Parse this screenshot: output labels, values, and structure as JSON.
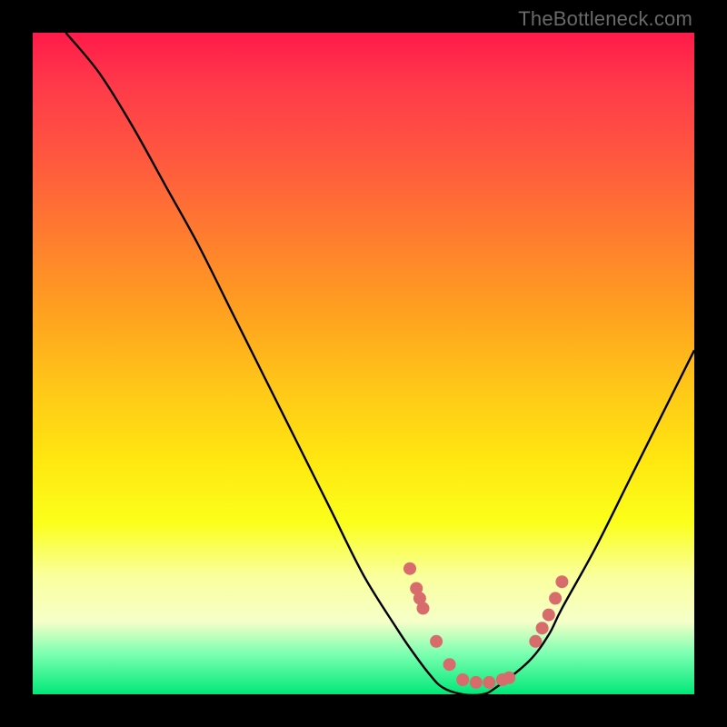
{
  "watermark": "TheBottleneck.com",
  "chart_data": {
    "type": "line",
    "title": "",
    "xlabel": "",
    "ylabel": "",
    "xlim": [
      0,
      100
    ],
    "ylim": [
      0,
      100
    ],
    "series": [
      {
        "name": "bottleneck-curve",
        "x": [
          5,
          10,
          15,
          20,
          25,
          30,
          35,
          40,
          45,
          50,
          55,
          57,
          60,
          62,
          65,
          68,
          70,
          75,
          78,
          80,
          85,
          90,
          95,
          100
        ],
        "values": [
          100,
          94,
          86,
          77,
          68,
          58,
          48,
          38,
          28,
          18,
          10,
          7,
          3,
          1,
          0,
          0,
          1,
          5,
          9,
          13,
          22,
          32,
          42,
          52
        ]
      }
    ],
    "markers": {
      "name": "highlight-points",
      "x": [
        57,
        58,
        58.5,
        59,
        61,
        63,
        65,
        67,
        69,
        71,
        72,
        76,
        77,
        78,
        79,
        80
      ],
      "values": [
        19,
        16,
        14.5,
        13,
        8,
        4.5,
        2.2,
        1.8,
        1.8,
        2.2,
        2.5,
        8,
        10,
        12,
        14.5,
        17
      ]
    }
  }
}
